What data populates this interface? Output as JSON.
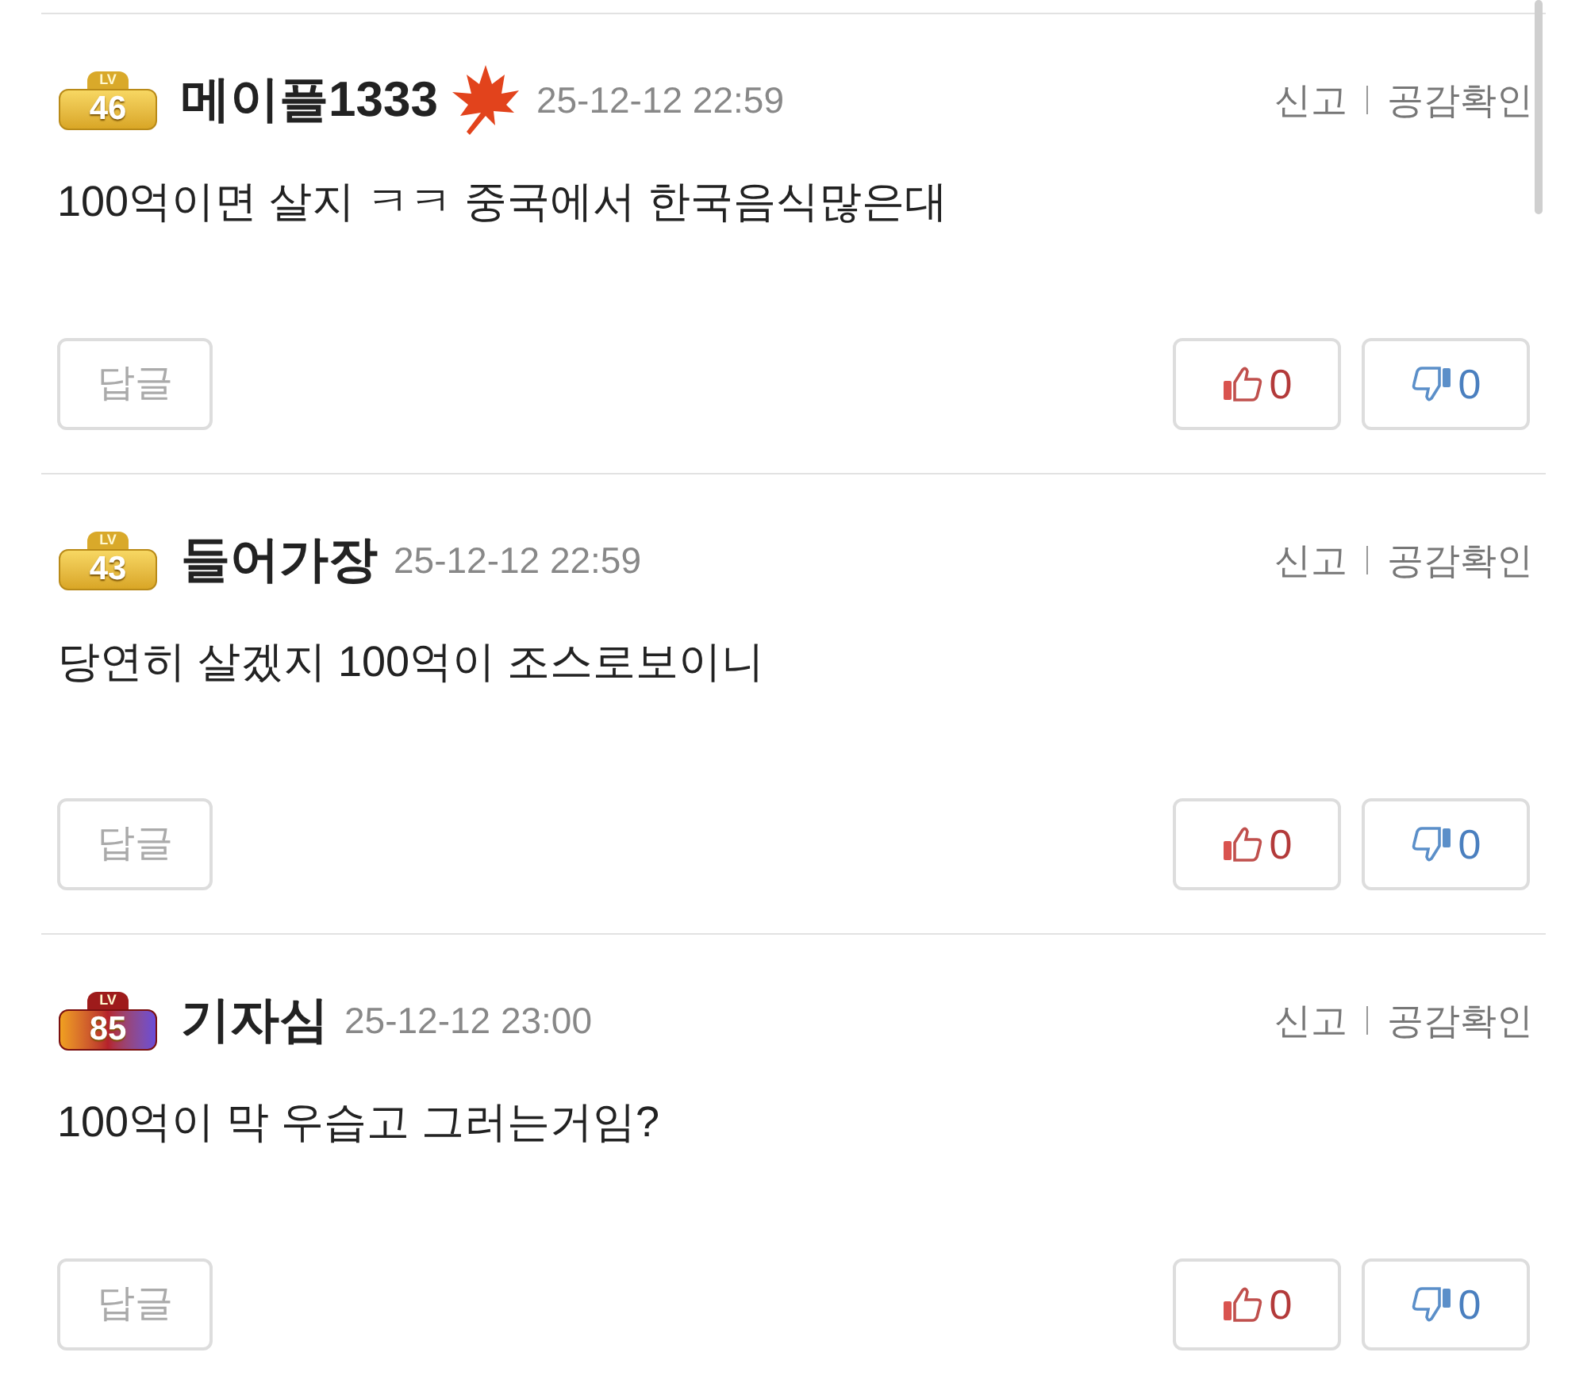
{
  "comments": [
    {
      "badge": {
        "lv_label": "LV",
        "number": "46",
        "kind": "gold"
      },
      "author": "메이플1333",
      "maple_leaf": true,
      "time": "25-12-12 22:59",
      "report": "신고",
      "empathy": "공감확인",
      "text": "100억이면 살지 ㅋㅋ 중국에서 한국음식많은대",
      "reply": "답글",
      "likes": "0",
      "dislikes": "0"
    },
    {
      "badge": {
        "lv_label": "LV",
        "number": "43",
        "kind": "gold"
      },
      "author": "들어가장",
      "maple_leaf": false,
      "time": "25-12-12 22:59",
      "report": "신고",
      "empathy": "공감확인",
      "text": "당연히 살겠지 100억이 조스로보이니",
      "reply": "답글",
      "likes": "0",
      "dislikes": "0"
    },
    {
      "badge": {
        "lv_label": "LV",
        "number": "85",
        "kind": "red"
      },
      "author": "기자심",
      "maple_leaf": false,
      "time": "25-12-12 23:00",
      "report": "신고",
      "empathy": "공감확인",
      "text": "100억이 막 우습고 그러는거임?",
      "reply": "답글",
      "likes": "0",
      "dislikes": "0"
    }
  ]
}
